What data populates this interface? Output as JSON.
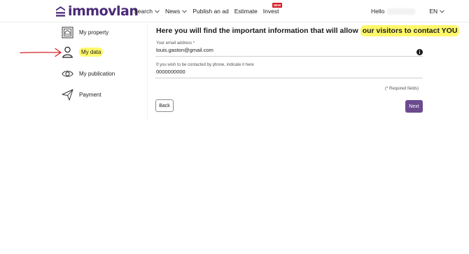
{
  "header": {
    "logo_text": "immovlan",
    "nav": [
      {
        "label": "Search"
      },
      {
        "label": "News"
      },
      {
        "label": "Publish an ad"
      },
      {
        "label": "Estimate"
      },
      {
        "label": "Invest",
        "badge": "NEW"
      }
    ],
    "greeting": "Hello",
    "language": "EN"
  },
  "sidebar": {
    "items": [
      {
        "label": "My property",
        "icon": "property-icon"
      },
      {
        "label": "My data",
        "icon": "user-icon",
        "highlighted": true
      },
      {
        "label": "My publication",
        "icon": "eye-icon"
      },
      {
        "label": "Payment",
        "icon": "send-icon"
      }
    ]
  },
  "main": {
    "title_prefix": "Here you will find the important information that will allow ",
    "title_highlight": "our visitors to contact YOU",
    "email": {
      "label": "Your email address *",
      "value": "louis.gaston@gmail.com"
    },
    "phone": {
      "label": "If you wish to be contacted by phone, indicate it here",
      "value": "0000000000"
    },
    "required_note": "(* Required fields)",
    "back_label": "Back",
    "next_label": "Next"
  },
  "colors": {
    "brand": "#4b2a78",
    "next_button": "#6c4a90",
    "highlight": "#fff86a",
    "annotation_arrow": "#d61f26",
    "badge": "#d71c29"
  }
}
